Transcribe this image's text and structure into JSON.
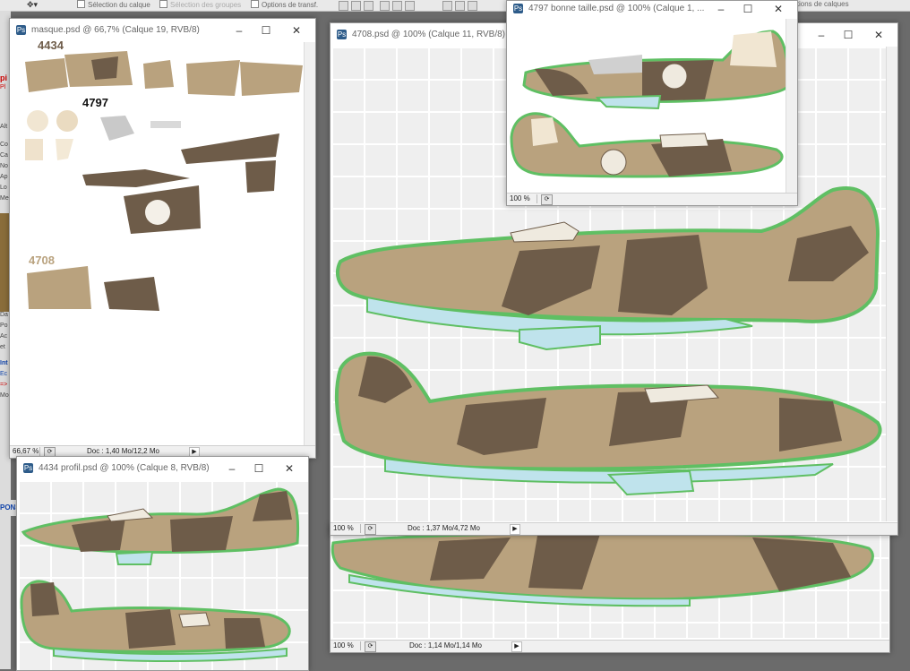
{
  "toolbar": {
    "select_layer": "Sélection du calque",
    "select_groups": "Sélection des groupes",
    "transform_options": "Options de transf.",
    "layer_positions": "sitions de calques"
  },
  "windows": {
    "masque": {
      "title": "masque.psd @ 66,7% (Calque 19, RVB/8)",
      "labels": [
        "4434",
        "4797",
        "4708"
      ],
      "zoom": "66,67 %",
      "doc": "Doc : 1,40 Mo/12,2 Mo"
    },
    "w4708": {
      "title": "4708.psd @ 100% (Calque 11, RVB/8)",
      "zoom": "100 %",
      "doc": "Doc : 1,37 Mo/4,72 Mo"
    },
    "w4797": {
      "title": "4797 bonne taille.psd @ 100% (Calque 1, ...",
      "zoom": "100 %"
    },
    "w4434": {
      "title": "4434 profil.psd @ 100% (Calque 8, RVB/8)"
    },
    "bottom": {
      "zoom": "100 %",
      "doc": "Doc : 1,14 Mo/1,14 Mo"
    }
  },
  "desktop_fragments": [
    "pi",
    "Pl",
    "Alt",
    "Co",
    "Ca",
    "No",
    "Ap",
    "Lo",
    "Me",
    "Da",
    "Po",
    "Ac",
    "et",
    "Int",
    "Ec",
    "=>",
    "Mo",
    "PONS"
  ],
  "colors": {
    "tan": "#b9a27e",
    "brown": "#6e5c49",
    "sky": "#bfe3ec",
    "outline": "#5fbf63"
  }
}
